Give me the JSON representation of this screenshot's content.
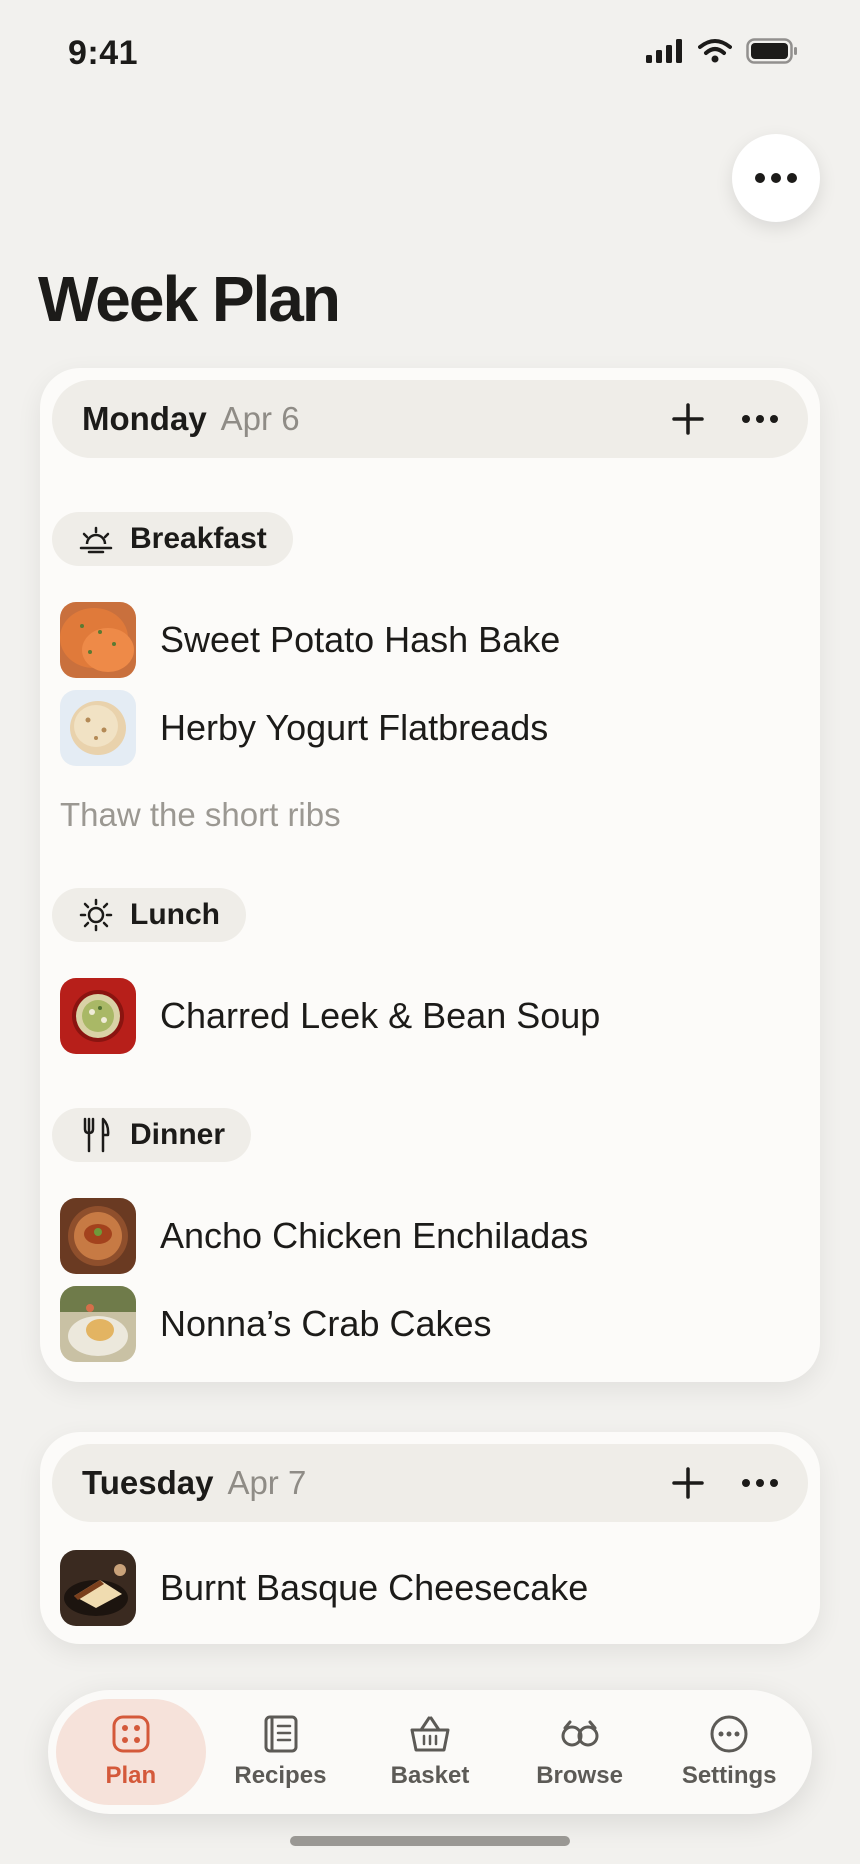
{
  "status_bar": {
    "time": "9:41"
  },
  "page_title": "Week Plan",
  "days": [
    {
      "name": "Monday",
      "date": "Apr 6",
      "sections": {
        "breakfast": {
          "label": "Breakfast",
          "icon": "sunrise-icon",
          "recipes": [
            "Sweet Potato Hash Bake",
            "Herby Yogurt Flatbreads"
          ],
          "note": "Thaw the short ribs"
        },
        "lunch": {
          "label": "Lunch",
          "icon": "sun-icon",
          "recipes": [
            "Charred Leek & Bean Soup"
          ]
        },
        "dinner": {
          "label": "Dinner",
          "icon": "fork-knife-icon",
          "recipes": [
            "Ancho Chicken Enchiladas",
            "Nonna’s Crab Cakes"
          ]
        }
      }
    },
    {
      "name": "Tuesday",
      "date": "Apr 7",
      "recipes": [
        "Burnt Basque Cheesecake"
      ]
    }
  ],
  "tabs": [
    {
      "label": "Plan",
      "icon": "plan-icon",
      "active": true
    },
    {
      "label": "Recipes",
      "icon": "recipes-icon",
      "active": false
    },
    {
      "label": "Basket",
      "icon": "basket-icon",
      "active": false
    },
    {
      "label": "Browse",
      "icon": "browse-icon",
      "active": false
    },
    {
      "label": "Settings",
      "icon": "settings-icon",
      "active": false
    }
  ],
  "colors": {
    "accent": "#d4593a",
    "accent_bg": "#f6e2da",
    "background": "#f2f1ee",
    "card": "#fcfbf9",
    "chip": "#efede8",
    "muted_text": "#8f8c86"
  }
}
